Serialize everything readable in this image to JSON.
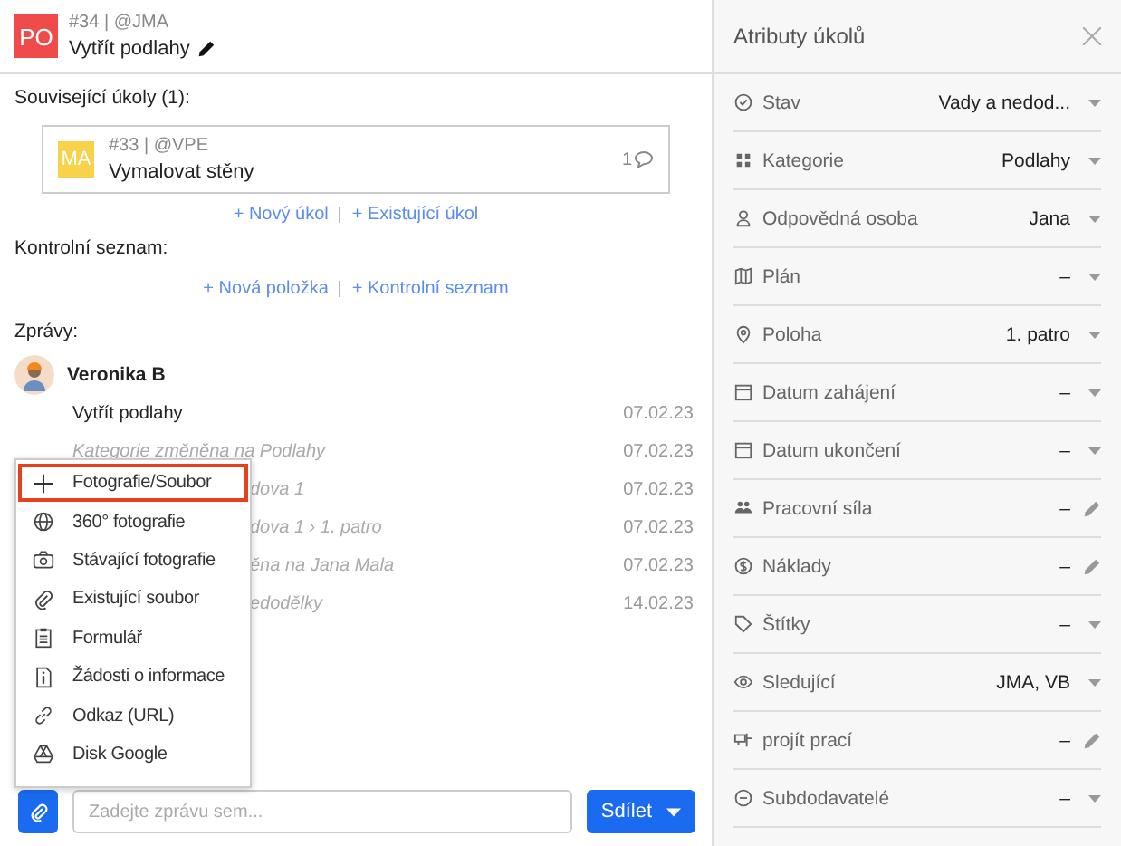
{
  "task": {
    "avatar": "PO",
    "meta": "#34 | @JMA",
    "title": "Vytřít podlahy"
  },
  "related": {
    "heading": "Související úkoly (1):",
    "tasks": [
      {
        "avatar": "MA",
        "meta": "#33 | @VPE",
        "title": "Vymalovat stěny",
        "comments": "1"
      }
    ],
    "links": [
      "+ Nový úkol",
      "+ Existující úkol"
    ]
  },
  "checklist": {
    "heading": "Kontrolní seznam:",
    "links": [
      "+ Nová položka",
      "+ Kontrolní seznam"
    ]
  },
  "messages": {
    "heading": "Zprávy:",
    "author": "Veronika B",
    "items": [
      {
        "text": "Vytřít podlahy",
        "date": "07.02.23",
        "kind": "message"
      },
      {
        "text": "Kategorie změněna na Podlahy",
        "date": "07.02.23",
        "kind": "event"
      },
      {
        "text": "dova 1",
        "date": "07.02.23",
        "kind": "covered"
      },
      {
        "text": "dova 1 › 1. patro",
        "date": "07.02.23",
        "kind": "covered"
      },
      {
        "text": "ěna na Jana Mala",
        "date": "07.02.23",
        "kind": "covered"
      },
      {
        "text": "edodělky",
        "date": "14.02.23",
        "kind": "covered"
      }
    ]
  },
  "attach_menu": {
    "items": [
      {
        "label": "Fotografie/Soubor",
        "selected": true
      },
      {
        "label": "360° fotografie",
        "selected": false
      },
      {
        "label": "Stávající fotografie",
        "selected": false
      },
      {
        "label": "Existující soubor",
        "selected": false
      },
      {
        "label": "Formulář",
        "selected": false
      },
      {
        "label": "Žádosti o informace",
        "selected": false
      },
      {
        "label": "Odkaz (URL)",
        "selected": false
      },
      {
        "label": "Disk Google",
        "selected": false
      }
    ]
  },
  "composer": {
    "placeholder": "Zadejte zprávu sem...",
    "send": "Sdílet"
  },
  "attributes": {
    "title": "Atributy úkolů",
    "rows": [
      {
        "label": "Stav",
        "value": "Vady a nedod...",
        "kind": "dropdown"
      },
      {
        "label": "Kategorie",
        "value": "Podlahy",
        "kind": "dropdown"
      },
      {
        "label": "Odpovědná osoba",
        "value": "Jana",
        "kind": "dropdown"
      },
      {
        "label": "Plán",
        "value": "–",
        "kind": "dropdown"
      },
      {
        "label": "Poloha",
        "value": "1. patro",
        "kind": "dropdown"
      },
      {
        "label": "Datum zahájení",
        "value": "–",
        "kind": "dropdown"
      },
      {
        "label": "Datum ukončení",
        "value": "–",
        "kind": "dropdown"
      },
      {
        "label": "Pracovní síla",
        "value": "–",
        "kind": "edit"
      },
      {
        "label": "Náklady",
        "value": "–",
        "kind": "edit"
      },
      {
        "label": "Štítky",
        "value": "–",
        "kind": "dropdown"
      },
      {
        "label": "Sledující",
        "value": "JMA, VB",
        "kind": "dropdown"
      },
      {
        "label": "projít prací",
        "value": "–",
        "kind": "edit"
      },
      {
        "label": "Subdodavatelé",
        "value": "–",
        "kind": "dropdown"
      }
    ]
  }
}
